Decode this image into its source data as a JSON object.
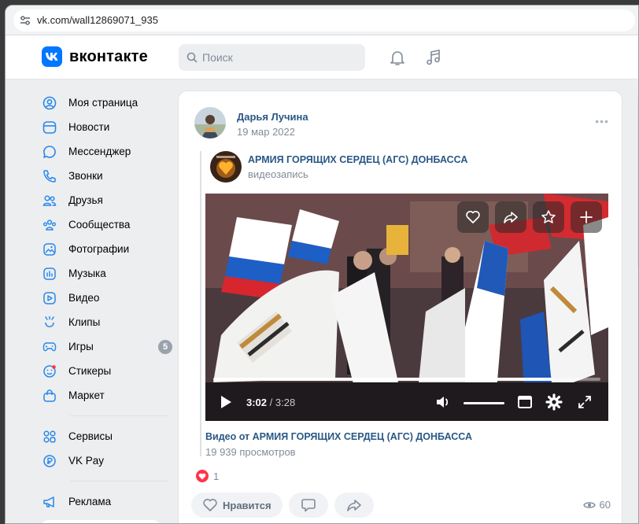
{
  "browser": {
    "url": "vk.com/wall12869071_935"
  },
  "header": {
    "logo_text": "вконтакте",
    "logo_letter": "VK",
    "search_placeholder": "Поиск"
  },
  "sidebar": {
    "items": [
      {
        "label": "Моя страница",
        "icon": "user-circle-icon"
      },
      {
        "label": "Новости",
        "icon": "news-icon"
      },
      {
        "label": "Мессенджер",
        "icon": "message-icon"
      },
      {
        "label": "Звонки",
        "icon": "phone-icon"
      },
      {
        "label": "Друзья",
        "icon": "friends-icon"
      },
      {
        "label": "Сообщества",
        "icon": "communities-icon"
      },
      {
        "label": "Фотографии",
        "icon": "photo-icon"
      },
      {
        "label": "Музыка",
        "icon": "music-icon"
      },
      {
        "label": "Видео",
        "icon": "video-icon"
      },
      {
        "label": "Клипы",
        "icon": "clips-icon"
      },
      {
        "label": "Игры",
        "icon": "gamepad-icon",
        "badge": "5"
      },
      {
        "label": "Стикеры",
        "icon": "sticker-icon"
      },
      {
        "label": "Маркет",
        "icon": "market-icon"
      }
    ],
    "items2": [
      {
        "label": "Сервисы",
        "icon": "services-icon"
      },
      {
        "label": "VK Pay",
        "icon": "vkpay-icon"
      }
    ],
    "items3": [
      {
        "label": "Реклама",
        "icon": "ads-icon"
      }
    ]
  },
  "post": {
    "author": "Дарья Лучина",
    "date": "19 мар 2022",
    "more": "•••",
    "repost": {
      "group_name": "АРМИЯ ГОРЯЩИХ СЕРДЕЦ (АГС) ДОНБАССА",
      "subtitle": "видеозапись"
    },
    "video": {
      "current_time": "3:02",
      "duration": "3:28",
      "progress": 0.875,
      "volume": 0.8,
      "title": "Видео от АРМИЯ ГОРЯЩИХ СЕРДЕЦ (АГС) ДОНБАССА",
      "views": "19 939 просмотров"
    },
    "likes_count": "1",
    "like_label": "Нравится",
    "views_count": "60"
  },
  "colors": {
    "accent": "#0077ff",
    "link": "#2a5885",
    "muted": "#818c99",
    "like": "#ff3347"
  }
}
